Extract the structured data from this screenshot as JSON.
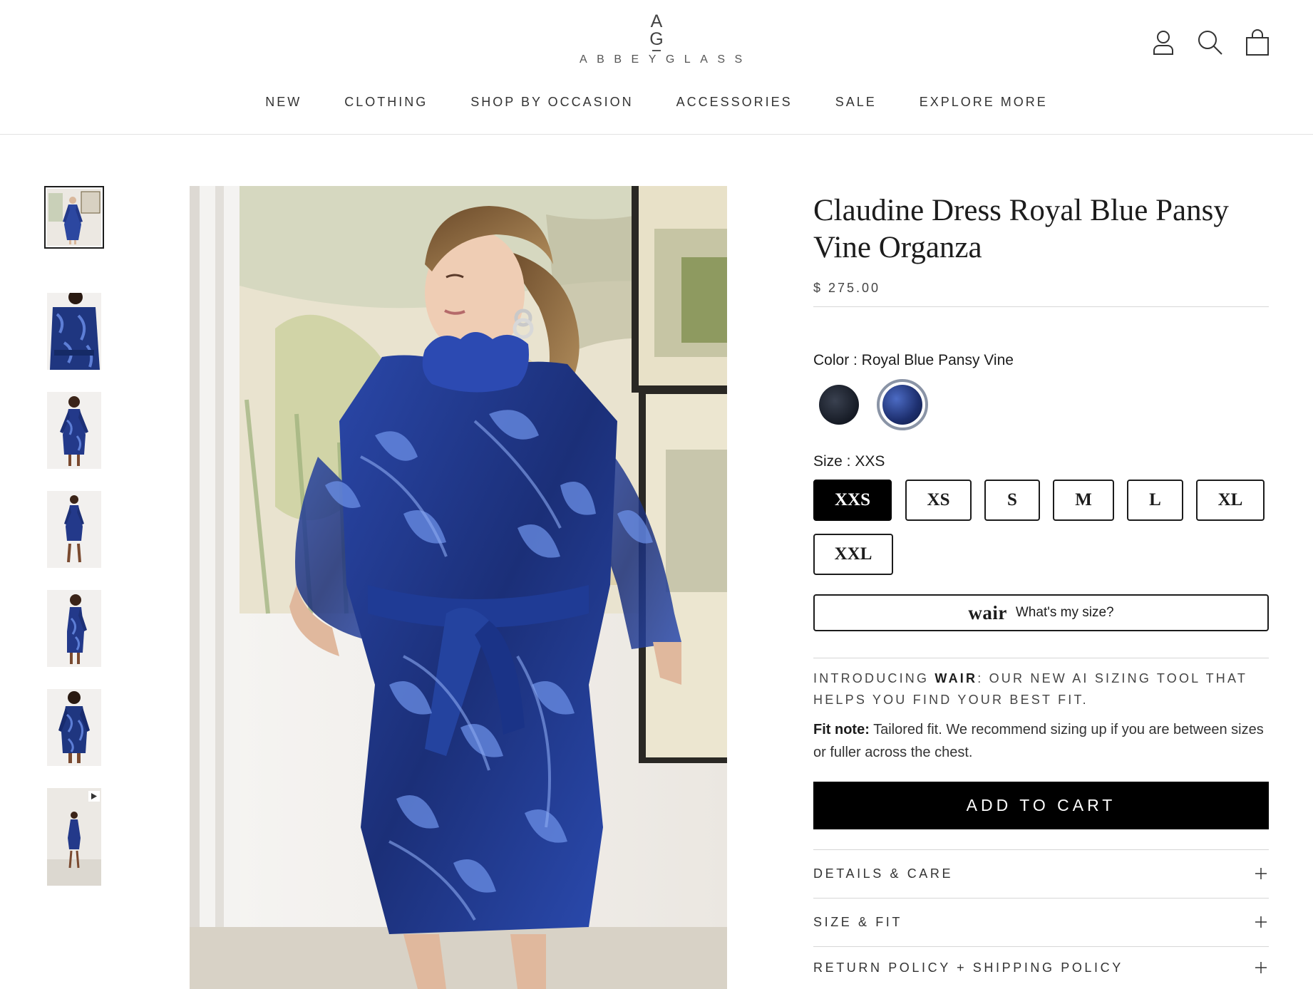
{
  "header": {
    "logo_mark_top": "A",
    "logo_mark_bottom": "G",
    "logo_word": "ABBEYGLASS",
    "icons": [
      "account-icon",
      "search-icon",
      "cart-icon"
    ]
  },
  "nav": {
    "items": [
      {
        "label": "NEW"
      },
      {
        "label": "CLOTHING"
      },
      {
        "label": "SHOP BY OCCASION"
      },
      {
        "label": "ACCESSORIES"
      },
      {
        "label": "SALE"
      },
      {
        "label": "EXPLORE MORE"
      }
    ]
  },
  "gallery": {
    "thumbnail_count": 7,
    "active_index": 0,
    "video_thumbnail_index": 6
  },
  "product": {
    "title": "Claudine Dress Royal Blue Pansy Vine Organza",
    "price": "$ 275.00",
    "color_label": "Color : Royal Blue Pansy Vine",
    "swatches": [
      {
        "name": "Black",
        "color": "#1b2130"
      },
      {
        "name": "Royal Blue Pansy Vine",
        "color": "#2c47a0",
        "selected": true
      }
    ],
    "size_label": "Size : XXS",
    "sizes": [
      {
        "label": "XXS",
        "selected": true
      },
      {
        "label": "XS"
      },
      {
        "label": "S"
      },
      {
        "label": "M"
      },
      {
        "label": "L"
      },
      {
        "label": "XL"
      },
      {
        "label": "XXL"
      }
    ],
    "wair": {
      "logo": "wair",
      "text": "What's my size?"
    },
    "intro": {
      "prefix": "INTRODUCING ",
      "brand": "WAIR",
      "suffix": ": OUR NEW AI SIZING TOOL THAT HELPS YOU FIND YOUR BEST FIT."
    },
    "fit_note": {
      "label": "Fit note:",
      "text": " Tailored fit. We recommend sizing up if you are between sizes or fuller across the chest."
    },
    "add_to_cart": "ADD TO CART",
    "accordions": [
      {
        "label": "DETAILS & CARE"
      },
      {
        "label": "SIZE & FIT"
      },
      {
        "label": "RETURN POLICY + SHIPPING POLICY"
      }
    ]
  },
  "colors": {
    "accent": "#000000",
    "dress_blue": "#2c47a0",
    "dress_navy": "#0f1a40"
  }
}
